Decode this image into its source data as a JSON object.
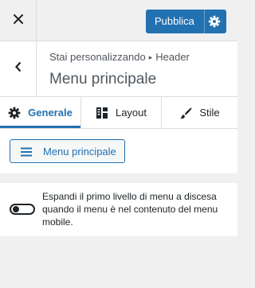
{
  "topbar": {
    "close_icon": "close-icon",
    "publish_label": "Pubblica",
    "publish_icon": "gear-icon",
    "accent": "#2271b1"
  },
  "header": {
    "back_icon": "chevron-left-icon",
    "breadcrumb_prefix": "Stai personalizzando",
    "breadcrumb_separator": "▸",
    "breadcrumb_section": "Header",
    "title": "Menu principale"
  },
  "tabs": [
    {
      "label": "Generale",
      "icon": "gear-icon",
      "active": true
    },
    {
      "label": "Layout",
      "icon": "layout-icon",
      "active": false
    },
    {
      "label": "Stile",
      "icon": "brush-icon",
      "active": false
    }
  ],
  "menu": {
    "button_label": "Menu principale",
    "button_icon": "hamburger-icon"
  },
  "mobile_toggle": {
    "label": "Espandi il primo livello di menu a discesa quando il menu è nel contenuto del menu mobile.",
    "checked": false
  }
}
